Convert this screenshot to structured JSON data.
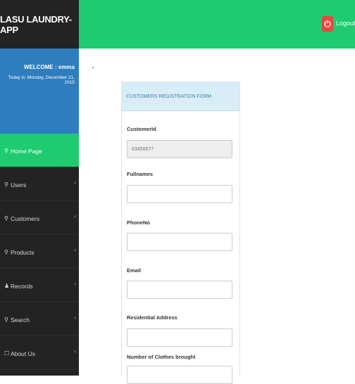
{
  "app": {
    "brand": "LASU LAUNDRY-APP",
    "logout_label": "Logout",
    "accent": "#1fcb70",
    "sidebar_bg": "#232323",
    "welcome_bg": "#2d7dbf"
  },
  "welcome": {
    "greeting": "WELCOME : emma",
    "date": "Today is: Monday, December 21, 2015"
  },
  "sidebar": {
    "items": [
      {
        "label": "Home Page",
        "icon": "user-icon",
        "active": true
      },
      {
        "label": "Users",
        "icon": "user-icon"
      },
      {
        "label": "Customers",
        "icon": "user-icon"
      },
      {
        "label": "Products",
        "icon": "user-icon"
      },
      {
        "label": "Records",
        "icon": "users-icon"
      },
      {
        "label": "Search",
        "icon": "user-icon"
      },
      {
        "label": "About Us",
        "icon": "square-icon"
      }
    ]
  },
  "form": {
    "title": "CUSTOMERS REGISTRATION FORM",
    "fields": [
      {
        "label": "CustomerId",
        "value": "63456677",
        "disabled": true
      },
      {
        "label": "Fullnames",
        "value": ""
      },
      {
        "label": "PhoneNo",
        "value": ""
      },
      {
        "label": "Email",
        "value": ""
      },
      {
        "label": "Residential Address",
        "value": ""
      },
      {
        "label": "Number of Clothes brought",
        "value": ""
      }
    ]
  }
}
